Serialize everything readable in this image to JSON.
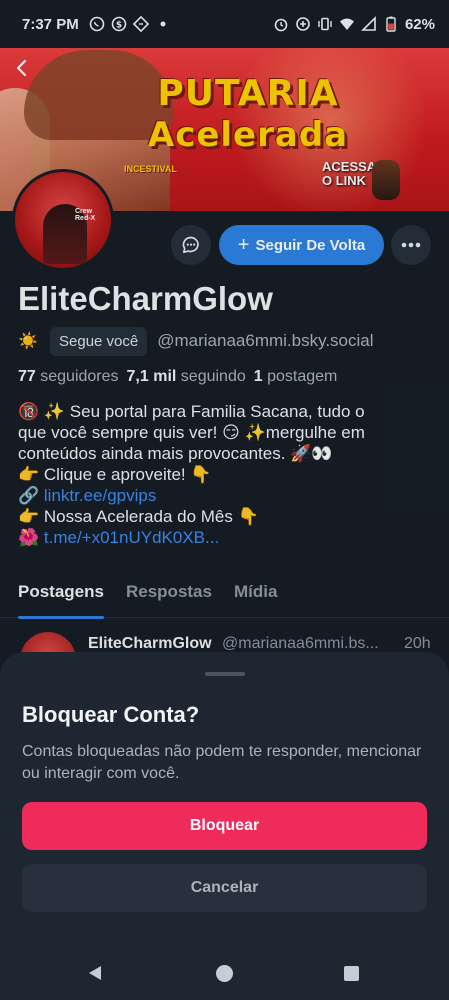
{
  "status_bar": {
    "time": "7:37 PM",
    "battery": "62%",
    "left_icons": [
      "whatsapp-icon",
      "dollar-icon",
      "diamond-app-icon",
      "dot-icon"
    ],
    "right_icons": [
      "alarm-icon",
      "data-saver-icon",
      "vibrate-icon",
      "wifi-icon",
      "signal-icon",
      "battery-icon"
    ]
  },
  "banner": {
    "title_line1": "PUTARIA",
    "title_line2": "Acelerada",
    "tag": "INCESTIVAL",
    "cta_line1": "ACESSA",
    "cta_line2": "O LINK"
  },
  "avatar": {
    "label_line1": "Crew",
    "label_line2": "Red-X"
  },
  "actions": {
    "follow_label": "Seguir De Volta",
    "follow_icon": "+"
  },
  "profile": {
    "display_name": "EliteCharmGlow",
    "emoji": "☀️",
    "follows_you": "Segue você",
    "handle": "@marianaa6mmi.bsky.social",
    "followers_count": "77",
    "followers_label": "seguidores",
    "following_count": "7,1 mil",
    "following_label": "seguindo",
    "posts_count": "1",
    "posts_label": "postagem"
  },
  "bio": {
    "line1": "🔞 ✨ Seu portal para Familia Sacana, tudo o",
    "line2": "que você sempre quis ver! 😏 ✨mergulhe em",
    "line3": "conteúdos ainda mais provocantes. 🚀👀",
    "line4": "👉 Clique e aproveite! 👇",
    "line5_prefix": "🔗 ",
    "line5_link": "linktr.ee/gpvips",
    "line6": "👉 Nossa Acelerada do Mês 👇",
    "line7_prefix": "🌺 ",
    "line7_link": "t.me/+x01nUYdK0XB..."
  },
  "tabs": [
    {
      "label": "Postagens",
      "active": true
    },
    {
      "label": "Respostas",
      "active": false
    },
    {
      "label": "Mídia",
      "active": false
    }
  ],
  "post": {
    "name": "EliteCharmGlow",
    "handle": "@marianaa6mmi.bs...",
    "time": "20h"
  },
  "sheet": {
    "title": "Bloquear Conta?",
    "description": "Contas bloqueadas não podem te responder, mencionar ou interagir com você.",
    "block_label": "Bloquear",
    "cancel_label": "Cancelar"
  },
  "colors": {
    "background": "#161e27",
    "accent_blue": "#2e84e8",
    "danger_pink": "#ef2b5c",
    "sheet_bg": "#1d2631"
  }
}
